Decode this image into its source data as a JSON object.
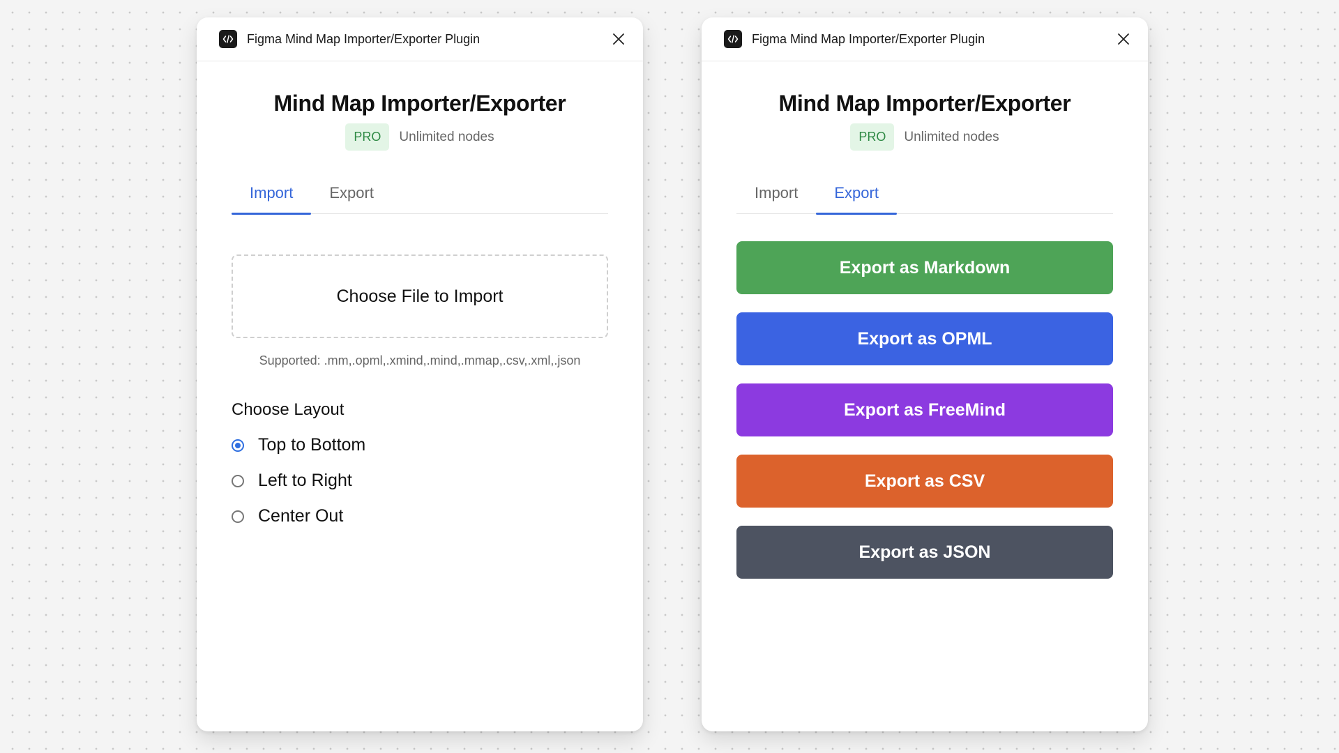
{
  "plugin_title": "Figma Mind Map Importer/Exporter Plugin",
  "app_title": "Mind Map Importer/Exporter",
  "pro_badge": "PRO",
  "plan_text": "Unlimited nodes",
  "tabs": {
    "import": "Import",
    "export": "Export"
  },
  "import_panel": {
    "choose_file_label": "Choose File to Import",
    "supported_text": "Supported: .mm,.opml,.xmind,.mind,.mmap,.csv,.xml,.json",
    "layout_heading": "Choose Layout",
    "layout_options": [
      {
        "label": "Top to Bottom",
        "checked": true
      },
      {
        "label": "Left to Right",
        "checked": false
      },
      {
        "label": "Center Out",
        "checked": false
      }
    ]
  },
  "export_panel": {
    "buttons": [
      {
        "label": "Export as Markdown",
        "color": "#4ea457"
      },
      {
        "label": "Export as OPML",
        "color": "#3b63e2"
      },
      {
        "label": "Export as FreeMind",
        "color": "#8c3ae0"
      },
      {
        "label": "Export as CSV",
        "color": "#dc622c"
      },
      {
        "label": "Export as JSON",
        "color": "#4d5361"
      }
    ]
  },
  "colors": {
    "accent": "#3566d9",
    "pro_badge_bg": "#e3f5e6",
    "pro_badge_text": "#2f8a45"
  },
  "icons": {
    "plugin": "code-icon",
    "close": "close-icon"
  }
}
